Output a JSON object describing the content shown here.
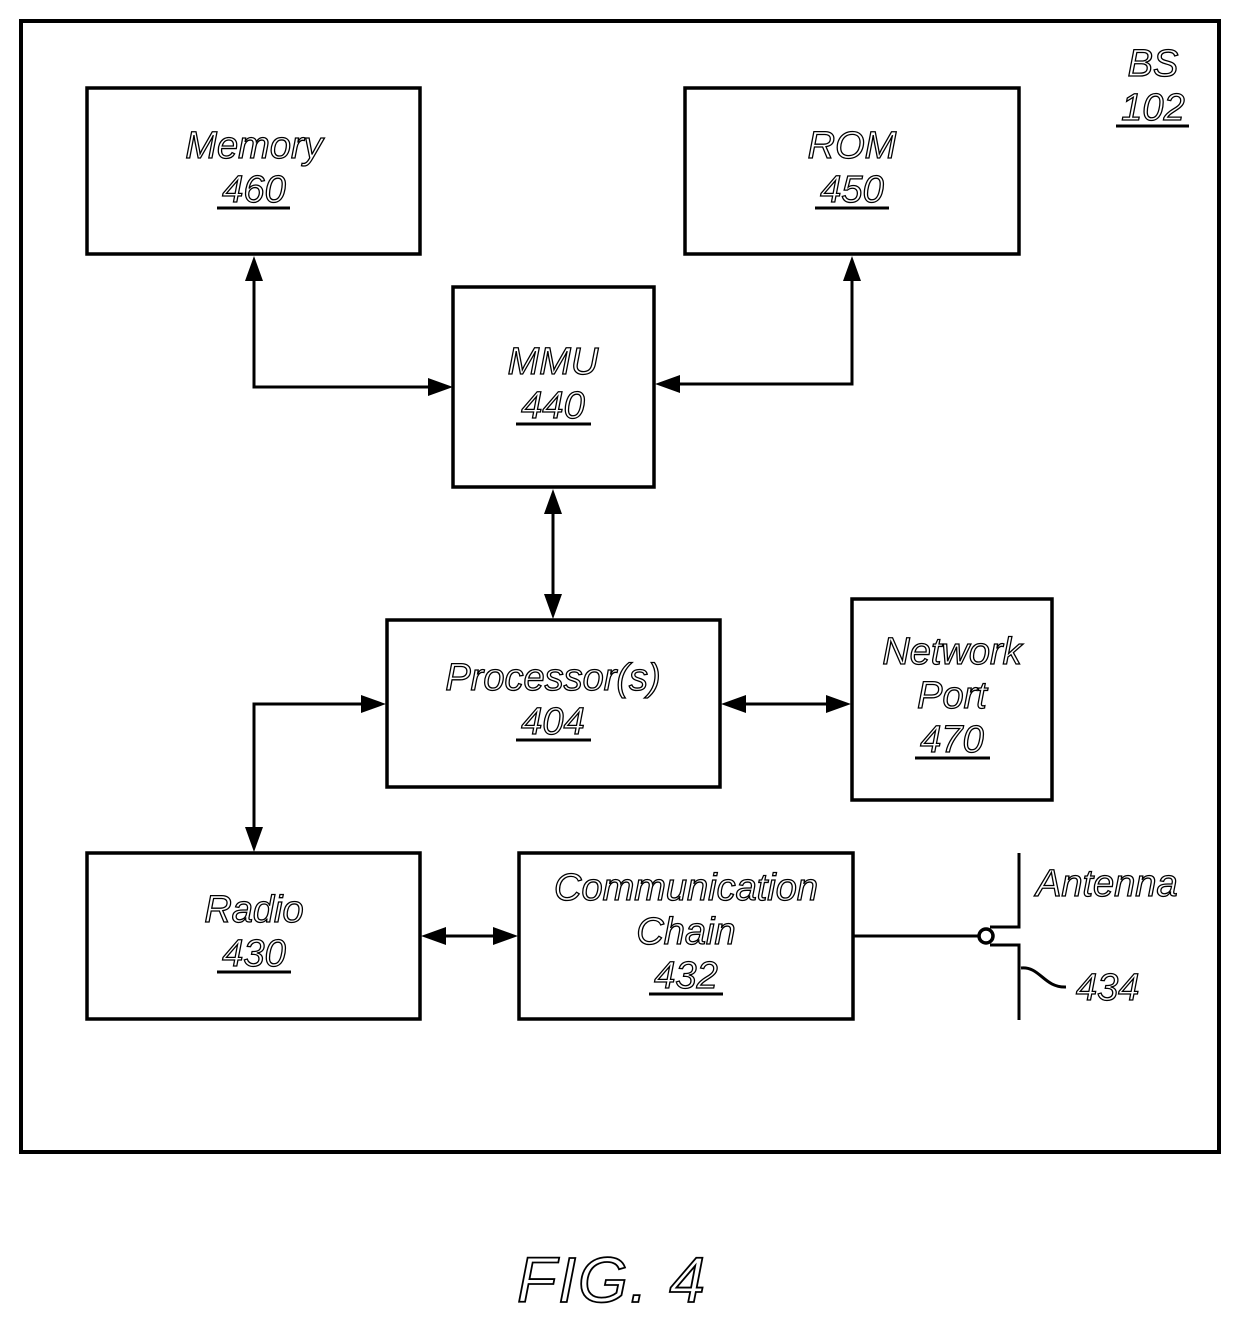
{
  "figure": {
    "caption": "FIG. 4",
    "container": {
      "name": "BS",
      "ref": "102"
    }
  },
  "blocks": {
    "memory": {
      "name": "Memory",
      "ref": "460"
    },
    "rom": {
      "name": "ROM",
      "ref": "450"
    },
    "mmu": {
      "name": "MMU",
      "ref": "440"
    },
    "processor": {
      "name": "Processor(s)",
      "ref": "404"
    },
    "network_port": {
      "name_line1": "Network",
      "name_line2": "Port",
      "ref": "470"
    },
    "radio": {
      "name": "Radio",
      "ref": "430"
    },
    "comm_chain": {
      "name_line1": "Communication",
      "name_line2": "Chain",
      "ref": "432"
    },
    "antenna": {
      "name": "Antenna",
      "ref": "434"
    }
  },
  "connections": [
    {
      "from": "Memory",
      "to": "MMU",
      "direction": "bidirectional"
    },
    {
      "from": "ROM",
      "to": "MMU",
      "direction": "bidirectional"
    },
    {
      "from": "MMU",
      "to": "Processor(s)",
      "direction": "bidirectional"
    },
    {
      "from": "Processor(s)",
      "to": "Network Port",
      "direction": "bidirectional"
    },
    {
      "from": "Radio",
      "to": "Processor(s)",
      "direction": "bidirectional"
    },
    {
      "from": "Radio",
      "to": "Communication Chain",
      "direction": "bidirectional"
    },
    {
      "from": "Communication Chain",
      "to": "Antenna",
      "direction": "line"
    }
  ]
}
